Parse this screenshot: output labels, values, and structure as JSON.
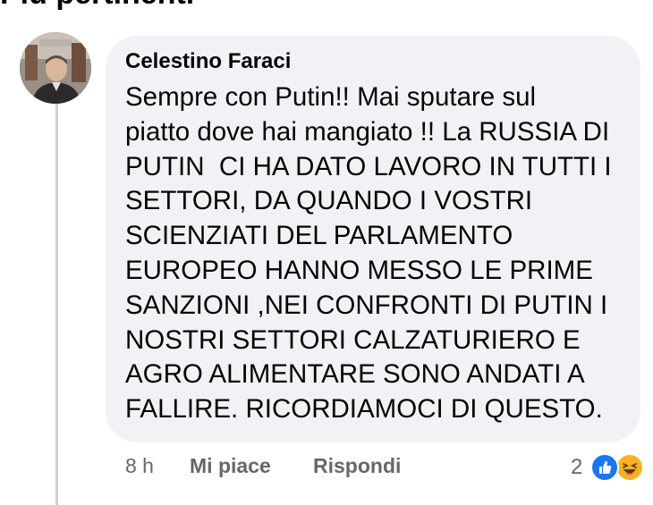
{
  "header": {
    "title": "Più pertinenti"
  },
  "comment": {
    "author": "Celestino Faraci",
    "lines": [
      "Sempre con Putin!! Mai sputare sul",
      "piatto dove hai mangiato !! La RUSSIA DI",
      "PUTIN  CI HA DATO LAVORO IN TUTTI I",
      "SETTORI, DA QUANDO I VOSTRI",
      "SCIENZIATI DEL PARLAMENTO",
      "EUROPEO HANNO MESSO LE PRIME",
      "SANZIONI ,NEI CONFRONTI DI PUTIN I",
      "NOSTRI SETTORI CALZATURIERO E",
      "AGRO ALIMENTARE SONO ANDATI A",
      "FALLIRE. RICORDIAMOCI DI QUESTO."
    ],
    "time": "8 h",
    "like_label": "Mi piace",
    "reply_label": "Rispondi",
    "reaction_count": "2",
    "reactions": [
      "like-icon",
      "haha-icon"
    ]
  },
  "colors": {
    "bubble_bg": "#f0f2f5",
    "meta_text": "#65676b",
    "like_blue": "#1877f2",
    "haha_yellow": "#f7b125"
  }
}
